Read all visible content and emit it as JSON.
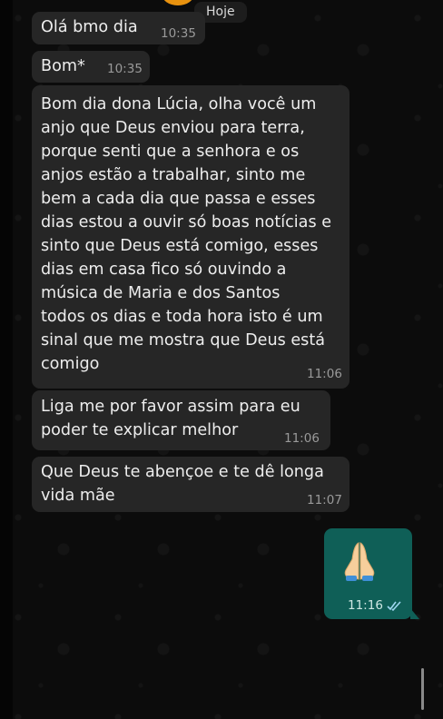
{
  "date_chip": "Hoje",
  "messages": [
    {
      "text": "Olá bmo dia",
      "time": "10:35"
    },
    {
      "text": "Bom*",
      "time": "10:35"
    },
    {
      "lines": [
        "Bom dia dona Lúcia, olha você um",
        "anjo que Deus enviou para terra,",
        "porque senti que a senhora e os",
        "anjos estão a trabalhar, sinto me",
        "bem a cada dia que passa e esses",
        "dias estou a ouvir só boas notícias e",
        "sinto que Deus está comigo, esses",
        "dias em casa fico só ouvindo a",
        "música de Maria e dos Santos",
        "todos os dias e toda hora isto é um",
        "sinal que me mostra que Deus está",
        "comigo"
      ],
      "time": "11:06"
    },
    {
      "lines": [
        "Liga me por favor assim para eu",
        "poder te explicar melhor"
      ],
      "time": "11:06"
    },
    {
      "lines": [
        "Que Deus te abençoe e te dê  longa",
        "vida mãe"
      ],
      "time": "11:07"
    }
  ],
  "outgoing": {
    "icon": "folded-hands-emoji",
    "time": "11:16",
    "status_icon": "double-check-read-icon"
  },
  "colors": {
    "incoming_bubble": "#262626",
    "outgoing_bubble": "#0f5f57",
    "background": "#0c0c0c"
  }
}
